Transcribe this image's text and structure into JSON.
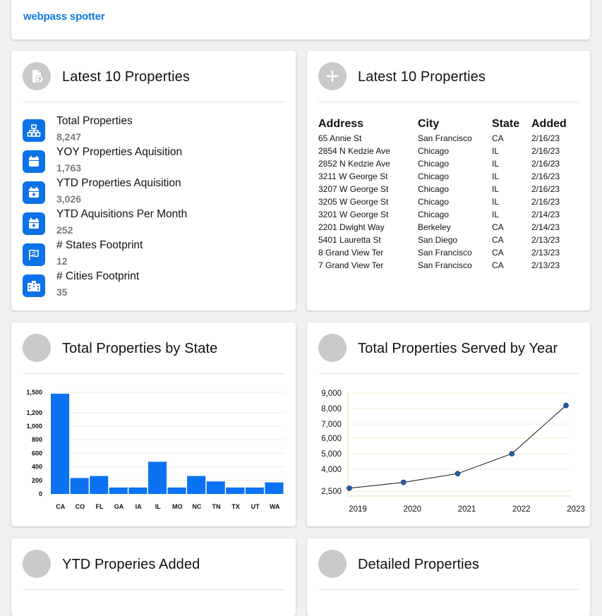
{
  "brand": {
    "name": "webpass spotter"
  },
  "stats_card": {
    "title": "Latest 10 Properties",
    "icon": "document-question-icon",
    "items": [
      {
        "label": "Total Properties",
        "value": "8,247",
        "icon": "network-icon"
      },
      {
        "label": "YOY Properties Aquisition",
        "value": "1,763",
        "icon": "calendar-icon"
      },
      {
        "label": "YTD Properties Aquisition",
        "value": "3,026",
        "icon": "calendar-plus-icon"
      },
      {
        "label": "YTD Aquisitions Per Month",
        "value": "252",
        "icon": "calendar-plus-icon"
      },
      {
        "label": "# States Footprint",
        "value": "12",
        "icon": "flag-icon"
      },
      {
        "label": "# Cities Footprint",
        "value": "35",
        "icon": "buildings-icon"
      }
    ]
  },
  "latest_card": {
    "title": "Latest 10 Properties",
    "icon": "plus-icon",
    "columns": [
      "Address",
      "City",
      "State",
      "Added"
    ],
    "rows": [
      [
        "65 Annie St",
        "San Francisco",
        "CA",
        "2/16/23"
      ],
      [
        "2854 N Kedzie Ave",
        "Chicago",
        "IL",
        "2/16/23"
      ],
      [
        "2852 N Kedzie Ave",
        "Chicago",
        "IL",
        "2/16/23"
      ],
      [
        "3211 W George St",
        "Chicago",
        "IL",
        "2/16/23"
      ],
      [
        "3207 W George St",
        "Chicago",
        "IL",
        "2/16/23"
      ],
      [
        "3205 W George St",
        "Chicago",
        "IL",
        "2/16/23"
      ],
      [
        "3201 W George St",
        "Chicago",
        "IL",
        "2/14/23"
      ],
      [
        "2201 Dwight Way",
        "Berkeley",
        "CA",
        "2/14/23"
      ],
      [
        "5401 Lauretta St",
        "San Diego",
        "CA",
        "2/13/23"
      ],
      [
        "8 Grand View Ter",
        "San Francisco",
        "CA",
        "2/13/23"
      ],
      [
        "7 Grand View Ter",
        "San Francisco",
        "CA",
        "2/13/23"
      ]
    ]
  },
  "state_card": {
    "title": "Total Properties by State"
  },
  "year_card": {
    "title": "Total Properties Served by Year"
  },
  "ytd_card": {
    "title": "YTD Properies Added"
  },
  "detailed_card": {
    "title": "Detailed Properties"
  },
  "colors": {
    "bar": "#0b72f2",
    "line": "#111111",
    "point": "#1f5fa8",
    "brand": "#0b7be2",
    "icon_bg": "#0b72e8"
  },
  "chart_data": [
    {
      "type": "bar",
      "title": "Total Properties by State",
      "categories": [
        "CA",
        "CO",
        "FL",
        "GA",
        "IA",
        "IL",
        "MO",
        "NC",
        "TN",
        "TX",
        "UT",
        "WA"
      ],
      "values": [
        1480,
        235,
        265,
        95,
        95,
        475,
        95,
        265,
        185,
        95,
        95,
        170
      ],
      "y_ticks": [
        "0",
        "200",
        "400",
        "600",
        "800",
        "1,000",
        "1,200",
        "1,500"
      ],
      "ylim": [
        0,
        1500
      ],
      "grid": true
    },
    {
      "type": "line",
      "title": "Total Properties Served by Year",
      "x": [
        "2019",
        "2020",
        "2021",
        "2022",
        "2023"
      ],
      "values": [
        2700,
        3100,
        3700,
        5000,
        8200
      ],
      "y_ticks": [
        "2,500",
        "4,000",
        "5,000",
        "6,000",
        "7,000",
        "8,000",
        "9,000"
      ],
      "ylim": [
        2500,
        9000
      ],
      "grid": true
    }
  ]
}
